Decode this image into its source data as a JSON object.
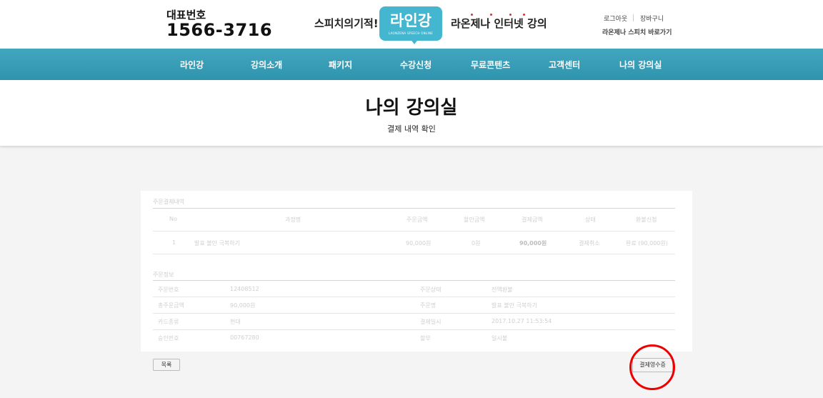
{
  "header": {
    "phone_label": "대표번호",
    "phone_number": "1566-3716",
    "slogan_left": "스피치의기적!",
    "logo_text": "라인강",
    "logo_sub": "LAONZENA SPEECH ONLINE",
    "slogan_right": "라온제나 인터넷 강의",
    "logout": "로그아웃",
    "cart": "장바구니",
    "shortcut": "라온제나 스피치 바로가기"
  },
  "nav": {
    "items": [
      "라인강",
      "강의소개",
      "패키지",
      "수강신청",
      "무료콘텐츠",
      "고객센터",
      "나의 강의실"
    ]
  },
  "page": {
    "title": "나의 강의실",
    "subtitle": "결제 내역 확인"
  },
  "order_payment": {
    "label": "주문결제내역",
    "columns": [
      "No",
      "과정명",
      "주문금액",
      "할인금액",
      "결제금액",
      "상태",
      "환불신청"
    ],
    "rows": [
      {
        "no": "1",
        "course": "발표 불안 극복하기",
        "order_amount": "90,000원",
        "discount": "0원",
        "paid": "90,000원",
        "status": "결제취소",
        "refund": "완료 (90,000원)"
      }
    ]
  },
  "order_info": {
    "label": "주문정보",
    "left": [
      {
        "key": "주문번호",
        "value": "12408512"
      },
      {
        "key": "총주문금액",
        "value": "90,000원"
      },
      {
        "key": "카드종류",
        "value": "현대"
      },
      {
        "key": "승인번호",
        "value": "00767280"
      }
    ],
    "right": [
      {
        "key": "주문상태",
        "value": "전액환불"
      },
      {
        "key": "주문명",
        "value": "발표 불안 극복하기"
      },
      {
        "key": "결제일시",
        "value": "2017.10.27 11:53:54"
      },
      {
        "key": "할부",
        "value": "일시불"
      }
    ]
  },
  "buttons": {
    "list": "목록",
    "receipt": "결제영수증"
  },
  "colors": {
    "nav": "#3a9fb8",
    "logo": "#44b6cf",
    "highlight": "#e00000"
  }
}
